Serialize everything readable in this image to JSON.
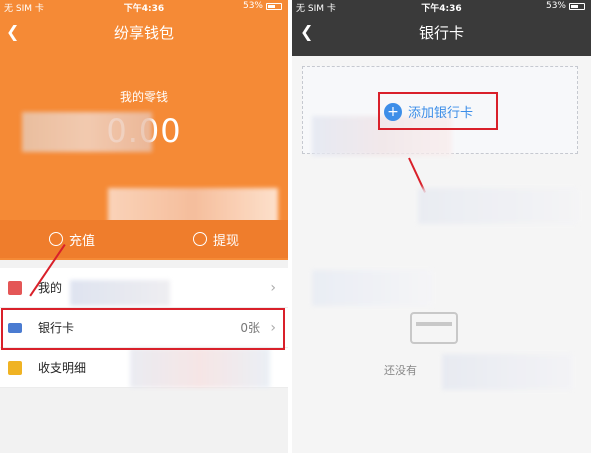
{
  "status": {
    "carrier": "无 SIM 卡",
    "time": "下午4:36",
    "battery": "53%"
  },
  "left": {
    "title": "纷享钱包",
    "change_label": "我的零钱",
    "change_amount": "0.00",
    "actions": [
      {
        "label": "充值",
        "icon": "coin-bag-icon"
      },
      {
        "label": "提现",
        "icon": "coin-bag-icon"
      }
    ],
    "rows": [
      {
        "label": "我的",
        "value": "",
        "icon": "wallet-icon"
      },
      {
        "label": "银行卡",
        "value": "0张",
        "icon": "card-icon"
      },
      {
        "label": "收支明细",
        "value": "",
        "icon": "bill-icon"
      }
    ]
  },
  "right": {
    "title": "银行卡",
    "add_label": "添加银行卡",
    "empty_text": "还没有"
  },
  "colors": {
    "orange": "#f58a36",
    "highlight": "#d9202a",
    "link": "#3d8ee8"
  }
}
